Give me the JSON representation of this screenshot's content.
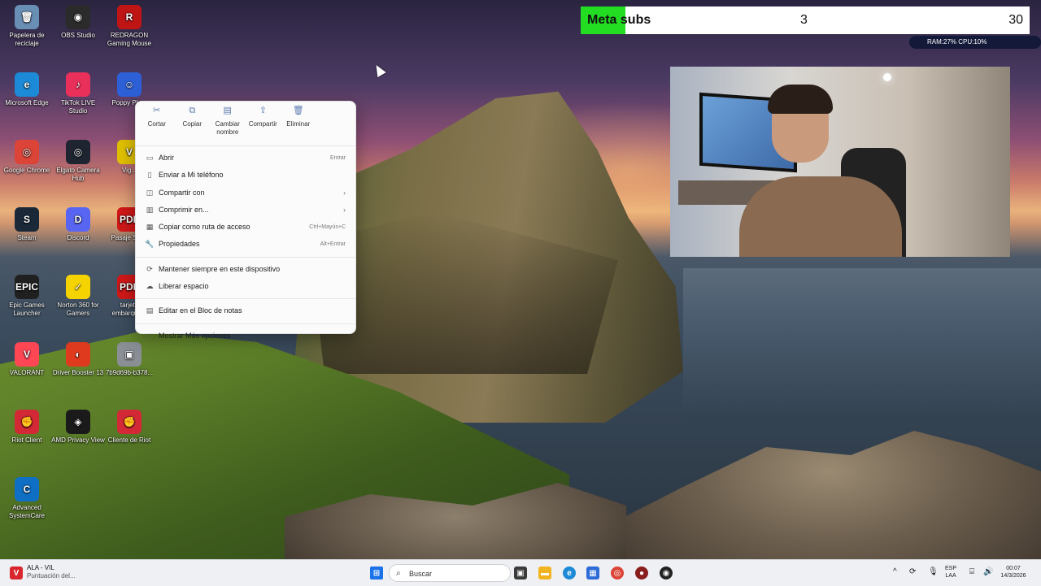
{
  "desktop_icons": [
    {
      "label": "Papelera de reciclaje",
      "glyph": "🗑",
      "color": "#6a8fb5",
      "icon": "recycle-bin-icon"
    },
    {
      "label": "OBS Studio",
      "glyph": "◉",
      "color": "#2b2b2b",
      "icon": "obs-icon"
    },
    {
      "label": "REDRAGON Gaming Mouse",
      "glyph": "R",
      "color": "#c01515",
      "icon": "redragon-icon"
    },
    {
      "label": "Microsoft Edge",
      "glyph": "e",
      "color": "#1c8ad6",
      "icon": "edge-icon"
    },
    {
      "label": "TikTok LIVE Studio",
      "glyph": "♪",
      "color": "#e8305a",
      "icon": "tiktok-icon"
    },
    {
      "label": "Poppy Pla...",
      "glyph": "☺",
      "color": "#2d5fd6",
      "icon": "poppy-playtime-icon"
    },
    {
      "label": "Google Chrome",
      "glyph": "◎",
      "color": "#db4437",
      "icon": "chrome-icon"
    },
    {
      "label": "Elgato Camera Hub",
      "glyph": "◎",
      "color": "#1e2430",
      "icon": "elgato-icon"
    },
    {
      "label": "Vig...",
      "glyph": "V",
      "color": "#e0c000",
      "icon": "vig-icon"
    },
    {
      "label": "Steam",
      "glyph": "S",
      "color": "#1b2838",
      "icon": "steam-icon"
    },
    {
      "label": "Discord",
      "glyph": "D",
      "color": "#5865f2",
      "icon": "discord-icon"
    },
    {
      "label": "Pasaje Sol...",
      "glyph": "PDF",
      "color": "#d01818",
      "icon": "pdf-icon"
    },
    {
      "label": "Epic Games Launcher",
      "glyph": "EPIC",
      "color": "#202020",
      "icon": "epic-games-icon"
    },
    {
      "label": "Norton 360 for Gamers",
      "glyph": "✓",
      "color": "#f5d300",
      "icon": "norton-icon"
    },
    {
      "label": "tarjeta embarque...",
      "glyph": "PDF",
      "color": "#d01818",
      "icon": "pdf-icon"
    },
    {
      "label": "VALORANT",
      "glyph": "V",
      "color": "#ff4655",
      "icon": "valorant-icon"
    },
    {
      "label": "Driver Booster 13",
      "glyph": "◐",
      "color": "#e03a1e",
      "icon": "driver-booster-icon"
    },
    {
      "label": "7b9d69b-b378...",
      "glyph": "▣",
      "color": "#8a8f96",
      "icon": "image-file-icon"
    },
    {
      "label": "Riot Client",
      "glyph": "✊",
      "color": "#d32936",
      "icon": "riot-client-icon"
    },
    {
      "label": "AMD Privacy View",
      "glyph": "◈",
      "color": "#1a1a1a",
      "icon": "amd-privacy-icon"
    },
    {
      "label": "Cliente de Riot",
      "glyph": "✊",
      "color": "#d32936",
      "icon": "riot-client-icon"
    },
    {
      "label": "Advanced SystemCare",
      "glyph": "C",
      "color": "#0f6fc5",
      "icon": "advanced-systemcare-icon"
    }
  ],
  "subs_goal": {
    "title": "Meta subs",
    "current": "3",
    "goal": "30",
    "progress_fraction": 0.1,
    "fill_color": "#22dd22"
  },
  "stats_overlay": {
    "text": "RAM:27% CPU:10%"
  },
  "context_menu": {
    "top_actions": [
      {
        "label": "Cortar",
        "icon": "scissors-icon",
        "glyph": "✂"
      },
      {
        "label": "Copiar",
        "icon": "copy-icon",
        "glyph": "⧉"
      },
      {
        "label": "Cambiar nombre",
        "icon": "rename-icon",
        "glyph": "▤"
      },
      {
        "label": "Compartir",
        "icon": "share-icon",
        "glyph": "⇪"
      },
      {
        "label": "Eliminar",
        "icon": "trash-icon",
        "glyph": "🗑"
      }
    ],
    "items": [
      {
        "label": "Abrir",
        "icon": "open-icon",
        "glyph": "▭",
        "shortcut": "Entrar",
        "submenu": false
      },
      {
        "label": "Enviar a Mi teléfono",
        "icon": "phone-icon",
        "glyph": "▯",
        "shortcut": "",
        "submenu": false
      },
      {
        "label": "Compartir con",
        "icon": "share-with-icon",
        "glyph": "◫",
        "shortcut": "",
        "submenu": true
      },
      {
        "label": "Comprimir en...",
        "icon": "compress-icon",
        "glyph": "▥",
        "shortcut": "",
        "submenu": true
      },
      {
        "label": "Copiar como ruta de acceso",
        "icon": "path-icon",
        "glyph": "▦",
        "shortcut": "Ctrl+Mayús+C",
        "submenu": false
      },
      {
        "label": "Propiedades",
        "icon": "wrench-icon",
        "glyph": "🔧",
        "shortcut": "Alt+Entrar",
        "submenu": false
      }
    ],
    "items2": [
      {
        "label": "Mantener siempre en este dispositivo",
        "icon": "cloud-sync-icon",
        "glyph": "⟳"
      },
      {
        "label": "Liberar espacio",
        "icon": "cloud-icon",
        "glyph": "☁"
      }
    ],
    "items3": [
      {
        "label": "Editar en el Bloc de notas",
        "icon": "notepad-icon",
        "glyph": "▤"
      }
    ],
    "items4": [
      {
        "label": "Mostrar Más opciones",
        "icon": "more-options-icon",
        "glyph": "⋯"
      }
    ]
  },
  "taskbar": {
    "notification_title": "ALA - VIL",
    "notification_sub": "Puntuación del...",
    "search_placeholder": "Buscar",
    "language_top": "ESP",
    "language_bottom": "LAA",
    "time": "00:07",
    "date": "14/3/2026"
  }
}
